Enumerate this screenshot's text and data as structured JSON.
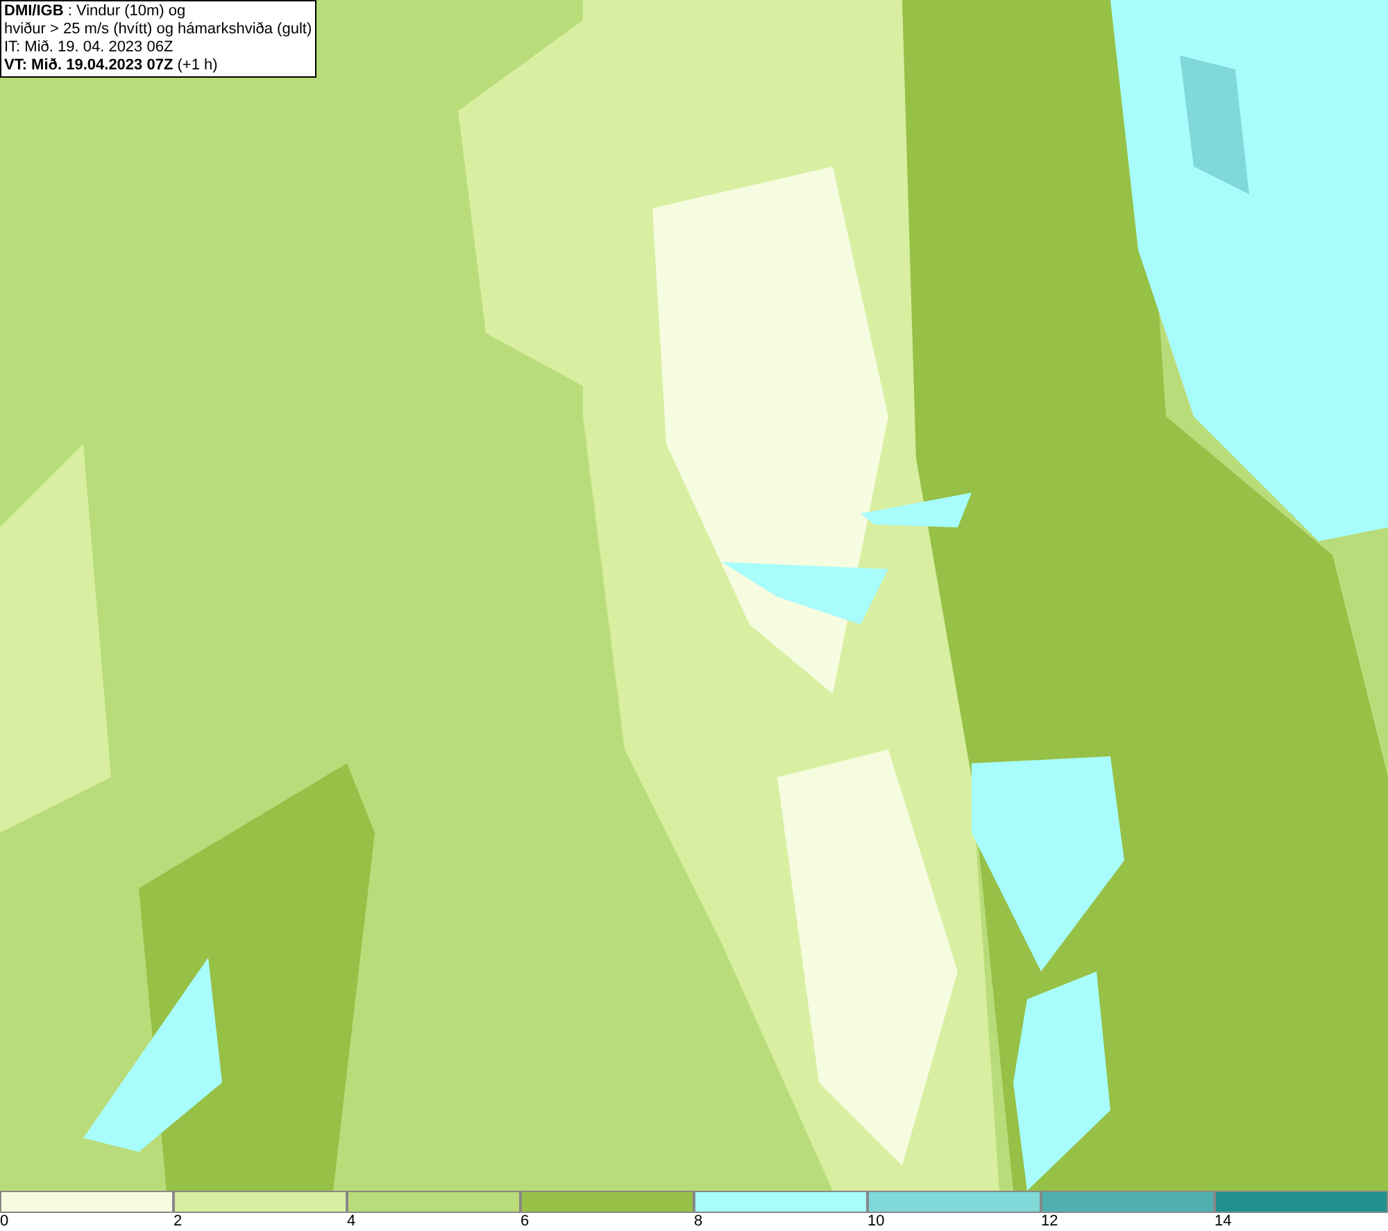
{
  "title_box": {
    "lines": [
      "**DMI/IGB** : Vindur (10m) og",
      "hviður > 25 m/s (hvítt) og hámarkshviða (gult)",
      "IT: Mið. 19. 04. 2023 06Z",
      "**VT: Mið. 19.04.2023 07Z** (+1 h)"
    ]
  },
  "legend": {
    "segments": [
      {
        "color": "#f5fce0",
        "tick": "0"
      },
      {
        "color": "#d8eea0",
        "tick": "2"
      },
      {
        "color": "#b9dc7a",
        "tick": "4"
      },
      {
        "color": "#96c046",
        "tick": "6"
      },
      {
        "color": "#a8fcfc",
        "tick": "8"
      },
      {
        "color": "#80d8d8",
        "tick": "10"
      },
      {
        "color": "#50b0b0",
        "tick": "12"
      },
      {
        "color": "#209090",
        "tick": "14"
      }
    ]
  }
}
